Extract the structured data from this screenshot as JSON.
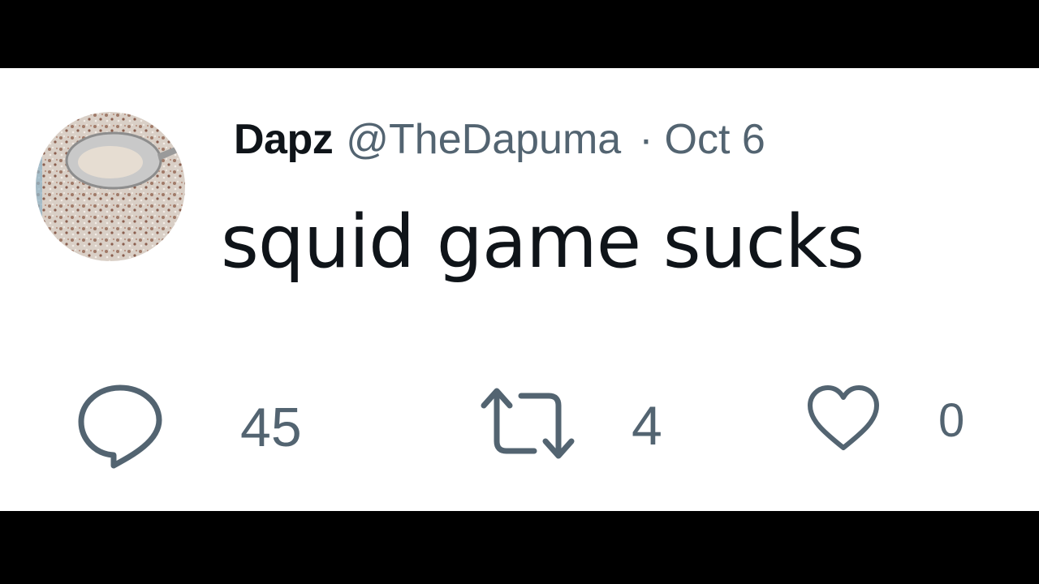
{
  "tweet": {
    "display_name": "Dapz",
    "handle": "@TheDapuma",
    "separator": "·",
    "date": "Oct 6",
    "text": "squid game sucks",
    "avatar_icon": "avatar-spoon-cereal-photo"
  },
  "actions": {
    "reply": {
      "icon": "reply-icon",
      "count": "45"
    },
    "retweet": {
      "icon": "retweet-icon",
      "count": "4"
    },
    "like": {
      "icon": "heart-icon",
      "count": "0"
    }
  },
  "colors": {
    "text_primary": "#0f1419",
    "text_secondary": "#536471",
    "background": "#ffffff",
    "letterbox": "#000000"
  }
}
